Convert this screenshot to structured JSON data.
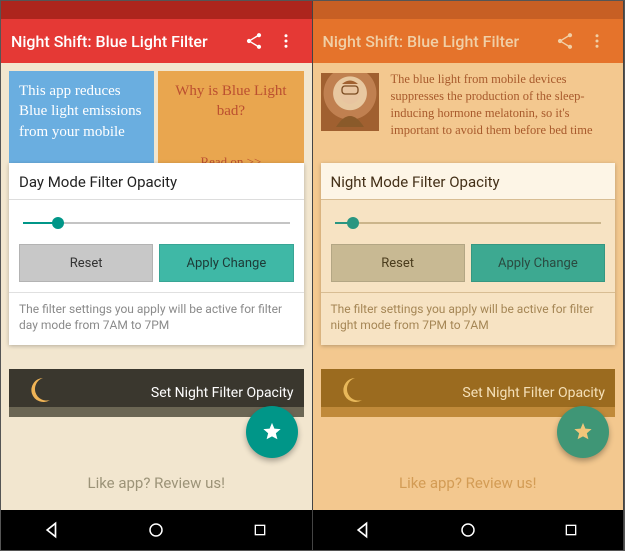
{
  "left": {
    "app_title": "Night Shift: Blue Light Filter",
    "info_blue": "This app reduces Blue light emissions from your mobile",
    "info_orange_title": "Why is Blue Light bad?",
    "info_orange_readon": "Read on >>",
    "card_title": "Day Mode Filter Opacity",
    "slider_percent": 13,
    "btn_reset": "Reset",
    "btn_apply": "Apply Change",
    "card_footer": "The filter settings you apply will be active for filter day mode from 7AM to 7PM",
    "night_banner": "Set Night Filter Opacity",
    "review": "Like app? Review us!"
  },
  "right": {
    "app_title": "Night Shift: Blue Light Filter",
    "info_text": "The blue light from mobile devices suppresses the production of the sleep-inducing hormone melatonin, so it's important to avoid them before bed time",
    "card_title": "Night Mode Filter Opacity",
    "slider_percent": 7,
    "btn_reset": "Reset",
    "btn_apply": "Apply Change",
    "card_footer": "The filter settings you apply will be active for filter night mode from 7PM to 7AM",
    "night_banner": "Set Night Filter Opacity",
    "review": "Like app? Review us!"
  }
}
